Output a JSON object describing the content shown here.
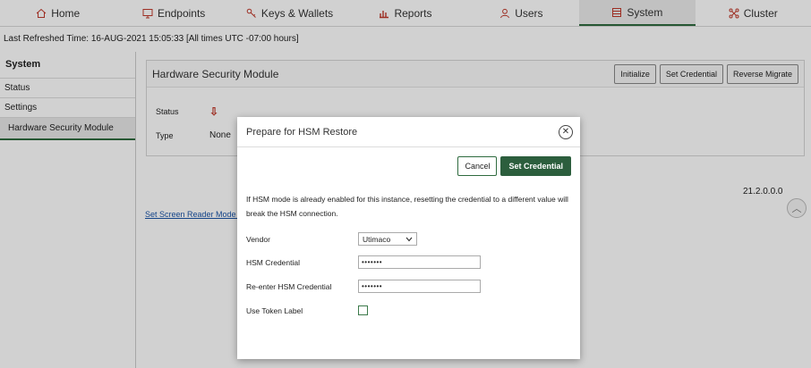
{
  "nav": {
    "tabs": [
      {
        "label": "Home",
        "icon": "home-icon"
      },
      {
        "label": "Endpoints",
        "icon": "monitor-icon"
      },
      {
        "label": "Keys & Wallets",
        "icon": "key-icon"
      },
      {
        "label": "Reports",
        "icon": "bar-chart-icon"
      },
      {
        "label": "Users",
        "icon": "user-icon"
      },
      {
        "label": "System",
        "icon": "server-icon"
      },
      {
        "label": "Cluster",
        "icon": "cluster-icon"
      }
    ],
    "active_tab": "System",
    "accent_color": "#2f6b3f"
  },
  "refresh": {
    "text": "Last Refreshed Time: 16-AUG-2021 15:05:33 [All times UTC -07:00 hours]"
  },
  "sidebar": {
    "title": "System",
    "items": [
      {
        "label": "Status"
      },
      {
        "label": "Settings"
      },
      {
        "label": "Hardware Security Module"
      }
    ],
    "active_item": "Hardware Security Module"
  },
  "panel": {
    "title": "Hardware Security Module",
    "buttons": {
      "initialize": "Initialize",
      "set_credential": "Set Credential",
      "reverse_migrate": "Reverse Migrate"
    },
    "status_label": "Status",
    "status_icon": "arrow-down-icon",
    "type_label": "Type",
    "type_value": "None"
  },
  "footer": {
    "version": "21.2.0.0.0",
    "reader_link": "Set Screen Reader Mode On"
  },
  "modal": {
    "title": "Prepare for HSM Restore",
    "cancel_label": "Cancel",
    "set_credential_label": "Set Credential",
    "message": "If HSM mode is already enabled for this instance, resetting the credential to a different value will break the HSM connection.",
    "vendor_label": "Vendor",
    "vendor_value": "Utimaco",
    "hsm_credential_label": "HSM Credential",
    "hsm_credential_value": "•••••••",
    "reenter_label": "Re-enter HSM Credential",
    "reenter_value": "•••••••",
    "token_label": "Use Token Label",
    "token_checked": false,
    "primary_color": "#2c5e3d"
  }
}
